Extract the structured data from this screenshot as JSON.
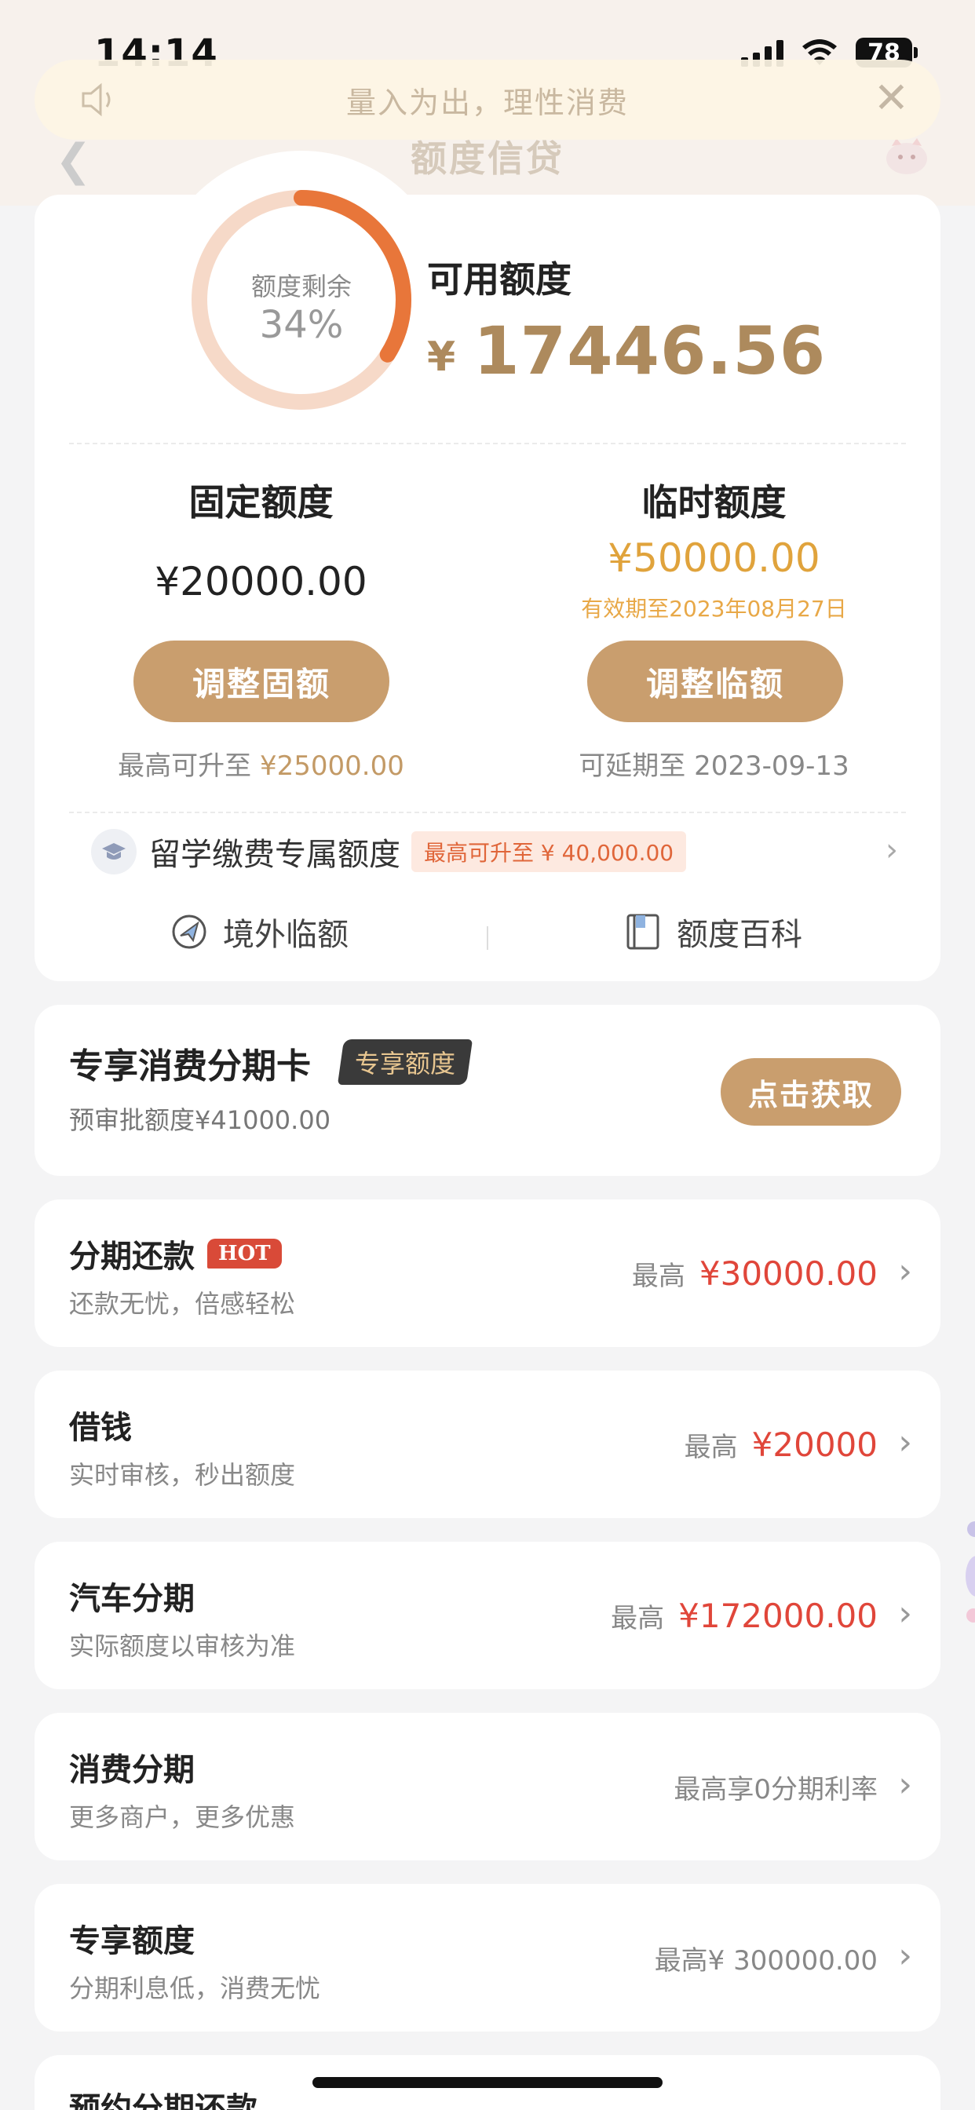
{
  "status_bar": {
    "time": "14:14",
    "battery": "78"
  },
  "notice": {
    "text": "量入为出，理性消费"
  },
  "nav": {
    "title": "额度信贷"
  },
  "credit": {
    "ring_label": "额度剩余",
    "ring_percent": "34%",
    "ring_fraction": 0.34,
    "available_label": "可用额度",
    "currency": "¥",
    "available_amount": "17446.56",
    "fixed": {
      "title": "固定额度",
      "amount": "¥20000.00",
      "button": "调整固额",
      "note_prefix": "最高可升至",
      "note_value": "¥25000.00"
    },
    "temporary": {
      "title": "临时额度",
      "amount": "¥50000.00",
      "expiry": "有效期至2023年08月27日",
      "button": "调整临额",
      "note": "可延期至 2023-09-13"
    },
    "study": {
      "label": "留学缴费专属额度",
      "tag": "最高可升至 ¥ 40,000.00"
    },
    "links": {
      "overseas": "境外临额",
      "encyclopedia": "额度百科"
    }
  },
  "exclusive_card": {
    "title": "专享消费分期卡",
    "badge": "专享额度",
    "subtitle": "预审批额度¥41000.00",
    "button": "点击获取"
  },
  "products": [
    {
      "title": "分期还款",
      "hot": "HOT",
      "subtitle": "还款无忧，倍感轻松",
      "prefix": "最高",
      "amount": "¥30000.00"
    },
    {
      "title": "借钱",
      "subtitle": "实时审核，秒出额度",
      "prefix": "最高",
      "amount": "¥20000"
    },
    {
      "title": "汽车分期",
      "subtitle": "实际额度以审核为准",
      "prefix": "最高",
      "amount": "¥172000.00"
    },
    {
      "title": "消费分期",
      "subtitle": "更多商户，更多优惠",
      "plain": "最高享0分期利率"
    },
    {
      "title": "专享额度",
      "subtitle": "分期利息低，消费无忧",
      "plain": "最高¥ 300000.00"
    },
    {
      "title": "预约分期还款"
    }
  ],
  "colors": {
    "gold": "#ad8a5d",
    "button": "#c99e6e",
    "ring": "#e8763a",
    "ring_track": "#f6d9c8",
    "red": "#e0463a"
  }
}
